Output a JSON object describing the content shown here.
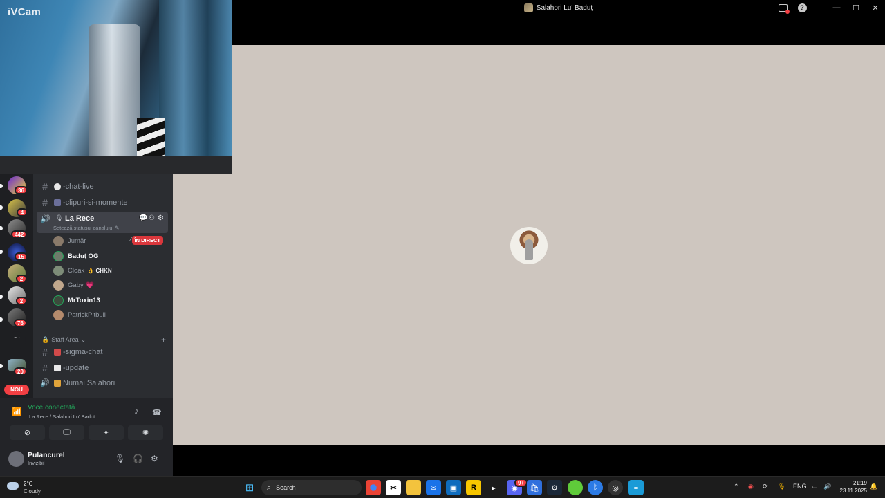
{
  "window": {
    "title": "Salahori Lu' Baduț",
    "controls": {
      "minimize": "—",
      "maximize": "☐",
      "close": "✕"
    },
    "inbox_icon": "inbox-icon",
    "help_label": "?"
  },
  "webcam": {
    "label": "iVCam"
  },
  "server_rail": {
    "badges": [
      "36",
      "4",
      "442",
      "15",
      "2",
      "2",
      "76",
      "20"
    ],
    "new_label": "NOU"
  },
  "channels": {
    "items": [
      {
        "name": "-chat-live",
        "emoji": "speech-balloon"
      },
      {
        "name": "-clipuri-si-momente",
        "emoji": "clapper"
      }
    ],
    "voice_channel": {
      "name": "La Rece",
      "status_hint": "Setează statusul canalului ✎",
      "members": [
        {
          "name": "Jumăr",
          "live": "ÎN DIRECT"
        },
        {
          "name": "Baduț OG"
        },
        {
          "name": "Cloak",
          "tag": "👌 CHKN"
        },
        {
          "name": "Gaby",
          "heart": "💗"
        },
        {
          "name": "MrToxin13"
        },
        {
          "name": "PatrickPitbull"
        }
      ]
    },
    "category": {
      "name": "Staff Area",
      "chevron": "⌄",
      "add": "+"
    },
    "staff_items": [
      {
        "name": "-sigma-chat"
      },
      {
        "name": "-update"
      },
      {
        "name": "Numai Salahori"
      }
    ]
  },
  "voice_panel": {
    "status": "Voce conectată",
    "location": "La Rece / Salahori Lu' Badut"
  },
  "user": {
    "name": "Pulancurel",
    "status": "Invizibil"
  },
  "taskbar": {
    "weather_temp": "2°C",
    "weather_desc": "Cloudy",
    "search_label": "Search",
    "language": "ENG",
    "time": "21:19",
    "date": "23.11.2025",
    "discord_badge": "9+"
  },
  "colors": {
    "stage_bg": "#cec6bf",
    "sidebar_bg": "#2b2d31",
    "rail_bg": "#1e1f22",
    "accent_green": "#23a55a",
    "badge_red": "#f23f43"
  }
}
